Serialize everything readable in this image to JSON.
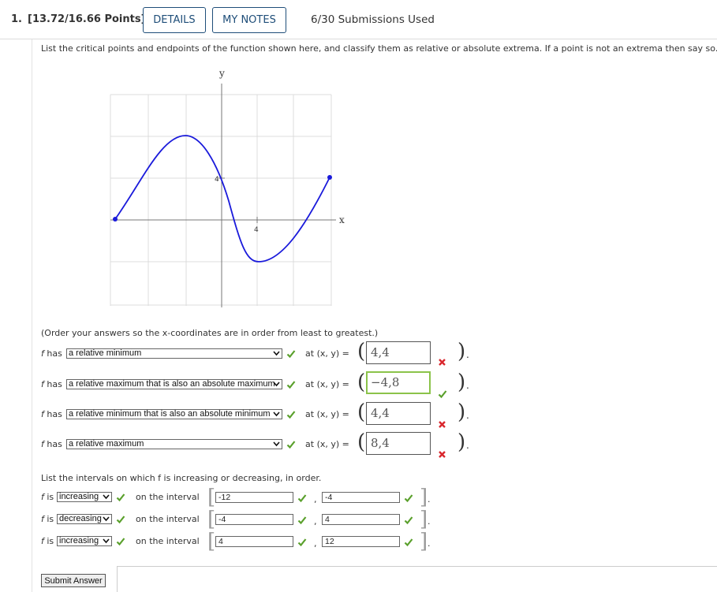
{
  "header": {
    "question_number": "1.",
    "points": "[13.72/16.66 Points]",
    "details_label": "DETAILS",
    "my_notes_label": "MY NOTES",
    "submissions": "6/30 Submissions Used"
  },
  "prompt": "List the critical points and endpoints of the function shown here, and classify them as relative or absolute extrema. If a point is not an extrema then say so.",
  "graph": {
    "y_label": "y",
    "x_label": "x",
    "x_tick": "4",
    "y_tick": "4"
  },
  "order_note": "(Order your answers so the x-coordinates are in order from least to greatest.)",
  "f_label": "f",
  "has_label": "has",
  "at_label": "at",
  "xy_label": "(x, y) =",
  "extrema_rows": [
    {
      "selected": "a relative minimum",
      "answer": "4,4",
      "answer_status": "incorrect"
    },
    {
      "selected": "a relative maximum that is also an absolute maximum",
      "answer": "−4,8",
      "answer_status": "correct"
    },
    {
      "selected": "a relative minimum that is also an absolute minimum",
      "answer": "4,4",
      "answer_status": "incorrect"
    },
    {
      "selected": "a relative maximum",
      "answer": "8,4",
      "answer_status": "incorrect"
    }
  ],
  "intervals_title": "List the intervals on which f is increasing or decreasing, in order.",
  "is_label": "is",
  "interval_label": "on the interval",
  "interval_rows": [
    {
      "selected": "increasing",
      "start": "-12",
      "end": "-4"
    },
    {
      "selected": "decreasing",
      "start": "-4",
      "end": "4"
    },
    {
      "selected": "increasing",
      "start": "4",
      "end": "12"
    }
  ],
  "submit_label": "Submit Answer",
  "colors": {
    "accent": "#1f4e79",
    "curve": "#1a1adb",
    "correct": "#5aa02c",
    "incorrect": "#d9262c",
    "correct_border": "#8bc34a"
  }
}
